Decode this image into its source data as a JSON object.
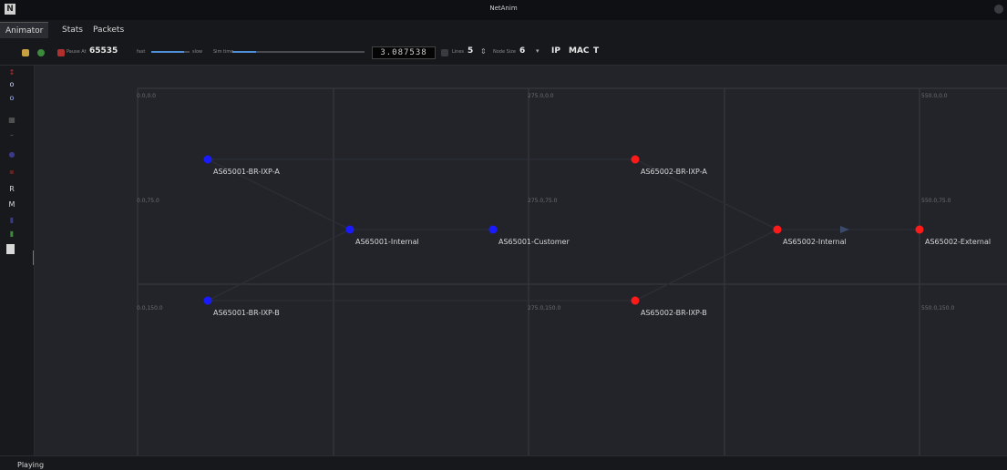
{
  "window": {
    "title": "NetAnim",
    "app_icon": "N"
  },
  "tabs": [
    {
      "label": "Animator"
    },
    {
      "label": "Stats"
    },
    {
      "label": "Packets"
    }
  ],
  "toolbar": {
    "pause_at_label": "Pause At",
    "pause_at_value": "65535",
    "fast_label": "fast",
    "slow_label": "slow",
    "sim_time_label": "Sim time",
    "time_display": "3.087538",
    "lines_label": "Lines",
    "lines_value": "5",
    "node_size_label": "Node Size",
    "node_size_value": "6",
    "ip_label": "IP",
    "mac_label": "MAC",
    "t_label": "T"
  },
  "sidebar": {
    "r_label": "R",
    "m_label": "M"
  },
  "grid_labels": {
    "tl": "0.0,0.0",
    "tm": "275.0,0.0",
    "tr": "550.0,0.0",
    "ml": "0.0,75.0",
    "mm": "275.0,75.0",
    "mr": "550.0,75.0",
    "bl": "0.0,150.0",
    "bm": "275.0,150.0",
    "br": "550.0,150.0"
  },
  "nodes": [
    {
      "label": "AS65001-BR-IXP-A",
      "color": "#1a1aff"
    },
    {
      "label": "AS65001-BR-IXP-B",
      "color": "#1a1aff"
    },
    {
      "label": "AS65001-Internal",
      "color": "#1a1aff"
    },
    {
      "label": "AS65001-Customer",
      "color": "#1a1aff"
    },
    {
      "label": "AS65002-BR-IXP-A",
      "color": "#ff1a1a"
    },
    {
      "label": "AS65002-BR-IXP-B",
      "color": "#ff1a1a"
    },
    {
      "label": "AS65002-Internal",
      "color": "#ff1a1a"
    },
    {
      "label": "AS65002-External",
      "color": "#ff1a1a"
    }
  ],
  "status": {
    "text": "Playing"
  },
  "colors": {
    "as65001": "#1a1aff",
    "as65002": "#ff1a1a",
    "accent": "#4f8fd8"
  }
}
